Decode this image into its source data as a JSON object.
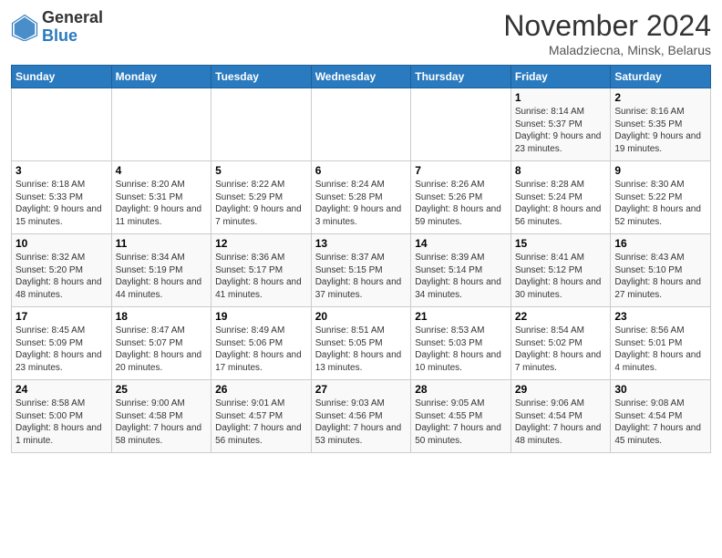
{
  "logo": {
    "general": "General",
    "blue": "Blue"
  },
  "title": "November 2024",
  "location": "Maladziecna, Minsk, Belarus",
  "headers": [
    "Sunday",
    "Monday",
    "Tuesday",
    "Wednesday",
    "Thursday",
    "Friday",
    "Saturday"
  ],
  "weeks": [
    [
      {
        "day": "",
        "info": ""
      },
      {
        "day": "",
        "info": ""
      },
      {
        "day": "",
        "info": ""
      },
      {
        "day": "",
        "info": ""
      },
      {
        "day": "",
        "info": ""
      },
      {
        "day": "1",
        "info": "Sunrise: 8:14 AM\nSunset: 5:37 PM\nDaylight: 9 hours and 23 minutes."
      },
      {
        "day": "2",
        "info": "Sunrise: 8:16 AM\nSunset: 5:35 PM\nDaylight: 9 hours and 19 minutes."
      }
    ],
    [
      {
        "day": "3",
        "info": "Sunrise: 8:18 AM\nSunset: 5:33 PM\nDaylight: 9 hours and 15 minutes."
      },
      {
        "day": "4",
        "info": "Sunrise: 8:20 AM\nSunset: 5:31 PM\nDaylight: 9 hours and 11 minutes."
      },
      {
        "day": "5",
        "info": "Sunrise: 8:22 AM\nSunset: 5:29 PM\nDaylight: 9 hours and 7 minutes."
      },
      {
        "day": "6",
        "info": "Sunrise: 8:24 AM\nSunset: 5:28 PM\nDaylight: 9 hours and 3 minutes."
      },
      {
        "day": "7",
        "info": "Sunrise: 8:26 AM\nSunset: 5:26 PM\nDaylight: 8 hours and 59 minutes."
      },
      {
        "day": "8",
        "info": "Sunrise: 8:28 AM\nSunset: 5:24 PM\nDaylight: 8 hours and 56 minutes."
      },
      {
        "day": "9",
        "info": "Sunrise: 8:30 AM\nSunset: 5:22 PM\nDaylight: 8 hours and 52 minutes."
      }
    ],
    [
      {
        "day": "10",
        "info": "Sunrise: 8:32 AM\nSunset: 5:20 PM\nDaylight: 8 hours and 48 minutes."
      },
      {
        "day": "11",
        "info": "Sunrise: 8:34 AM\nSunset: 5:19 PM\nDaylight: 8 hours and 44 minutes."
      },
      {
        "day": "12",
        "info": "Sunrise: 8:36 AM\nSunset: 5:17 PM\nDaylight: 8 hours and 41 minutes."
      },
      {
        "day": "13",
        "info": "Sunrise: 8:37 AM\nSunset: 5:15 PM\nDaylight: 8 hours and 37 minutes."
      },
      {
        "day": "14",
        "info": "Sunrise: 8:39 AM\nSunset: 5:14 PM\nDaylight: 8 hours and 34 minutes."
      },
      {
        "day": "15",
        "info": "Sunrise: 8:41 AM\nSunset: 5:12 PM\nDaylight: 8 hours and 30 minutes."
      },
      {
        "day": "16",
        "info": "Sunrise: 8:43 AM\nSunset: 5:10 PM\nDaylight: 8 hours and 27 minutes."
      }
    ],
    [
      {
        "day": "17",
        "info": "Sunrise: 8:45 AM\nSunset: 5:09 PM\nDaylight: 8 hours and 23 minutes."
      },
      {
        "day": "18",
        "info": "Sunrise: 8:47 AM\nSunset: 5:07 PM\nDaylight: 8 hours and 20 minutes."
      },
      {
        "day": "19",
        "info": "Sunrise: 8:49 AM\nSunset: 5:06 PM\nDaylight: 8 hours and 17 minutes."
      },
      {
        "day": "20",
        "info": "Sunrise: 8:51 AM\nSunset: 5:05 PM\nDaylight: 8 hours and 13 minutes."
      },
      {
        "day": "21",
        "info": "Sunrise: 8:53 AM\nSunset: 5:03 PM\nDaylight: 8 hours and 10 minutes."
      },
      {
        "day": "22",
        "info": "Sunrise: 8:54 AM\nSunset: 5:02 PM\nDaylight: 8 hours and 7 minutes."
      },
      {
        "day": "23",
        "info": "Sunrise: 8:56 AM\nSunset: 5:01 PM\nDaylight: 8 hours and 4 minutes."
      }
    ],
    [
      {
        "day": "24",
        "info": "Sunrise: 8:58 AM\nSunset: 5:00 PM\nDaylight: 8 hours and 1 minute."
      },
      {
        "day": "25",
        "info": "Sunrise: 9:00 AM\nSunset: 4:58 PM\nDaylight: 7 hours and 58 minutes."
      },
      {
        "day": "26",
        "info": "Sunrise: 9:01 AM\nSunset: 4:57 PM\nDaylight: 7 hours and 56 minutes."
      },
      {
        "day": "27",
        "info": "Sunrise: 9:03 AM\nSunset: 4:56 PM\nDaylight: 7 hours and 53 minutes."
      },
      {
        "day": "28",
        "info": "Sunrise: 9:05 AM\nSunset: 4:55 PM\nDaylight: 7 hours and 50 minutes."
      },
      {
        "day": "29",
        "info": "Sunrise: 9:06 AM\nSunset: 4:54 PM\nDaylight: 7 hours and 48 minutes."
      },
      {
        "day": "30",
        "info": "Sunrise: 9:08 AM\nSunset: 4:54 PM\nDaylight: 7 hours and 45 minutes."
      }
    ]
  ]
}
